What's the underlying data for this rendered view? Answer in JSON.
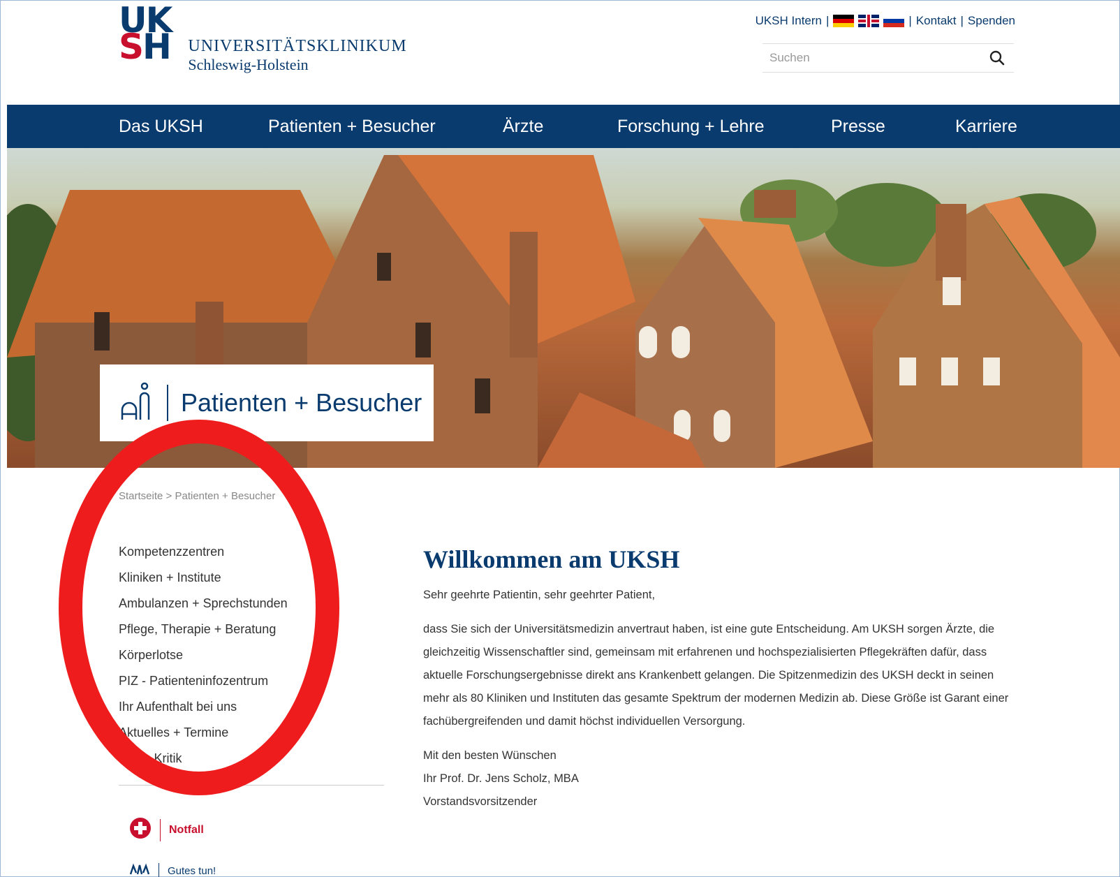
{
  "logo": {
    "mark_top": "UK",
    "mark_bottom_s": "S",
    "mark_bottom_h": "H",
    "line1": "UNIVERSITÄTSKLINIKUM",
    "line2": "Schleswig-Holstein"
  },
  "top_links": {
    "intern": "UKSH Intern",
    "separator": "|",
    "kontakt": "Kontakt",
    "spenden": "Spenden",
    "flags": [
      "flag-de-icon",
      "flag-uk-icon",
      "flag-ru-icon"
    ]
  },
  "search": {
    "placeholder": "Suchen",
    "value": "",
    "icon": "search-icon"
  },
  "nav": {
    "items": [
      "Das UKSH",
      "Patienten + Besucher",
      "Ärzte",
      "Forschung + Lehre",
      "Presse",
      "Karriere"
    ]
  },
  "hero": {
    "section_title": "Patienten + Besucher",
    "icon": "patient-visitor-icon"
  },
  "breadcrumb": {
    "home": "Startseite",
    "separator": ">",
    "current": "Patienten + Besucher"
  },
  "sidebar": {
    "items": [
      "Kompetenzzentren",
      "Kliniken + Institute",
      "Ambulanzen + Sprechstunden",
      "Pflege, Therapie + Beratung",
      "Körperlotse",
      "PIZ - Patienteninfozentrum",
      "Ihr Aufenthalt bei uns",
      "Aktuelles + Termine",
      "Lob + Kritik"
    ],
    "notfall": "Notfall",
    "gutes_tun": "Gutes tun!"
  },
  "main": {
    "heading": "Willkommen am UKSH",
    "greeting": "Sehr geehrte Patientin, sehr geehrter Patient,",
    "body": "dass Sie sich der Universitätsmedizin anvertraut haben, ist eine gute Entscheidung. Am UKSH sorgen Ärzte, die gleichzeitig Wissenschaftler sind, gemeinsam mit erfahrenen und hochspezialisierten Pflegekräften dafür, dass aktuelle Forschungsergebnisse direkt ans Krankenbett gelangen. Die Spitzenmedizin des UKSH deckt in seinen mehr als 80 Kliniken und Instituten das gesamte Spektrum der modernen Medizin ab. Diese Größe ist Garant einer fachübergreifenden und damit höchst individuellen Versorgung.",
    "closing": "Mit den besten Wünschen",
    "signer": "Ihr Prof. Dr. Jens Scholz, MBA",
    "role": "Vorstandsvorsitzender"
  },
  "colors": {
    "brand_blue": "#0a3b6e",
    "brand_red": "#c8102e",
    "annotation_red": "#ee1c1c"
  }
}
